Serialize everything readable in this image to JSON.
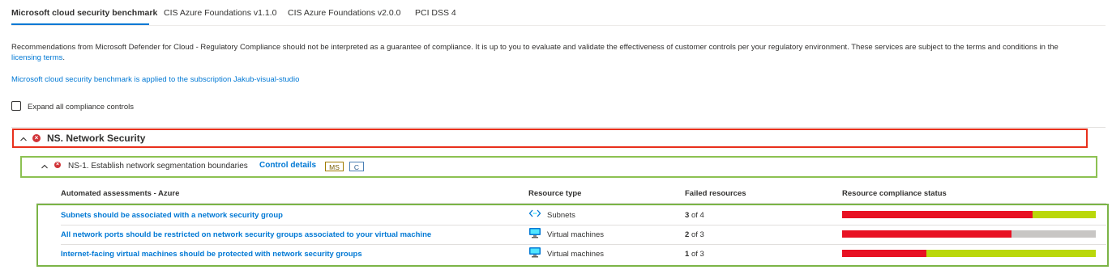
{
  "tabs": [
    {
      "label": "Microsoft cloud security benchmark",
      "active": true
    },
    {
      "label": "CIS Azure Foundations v1.1.0"
    },
    {
      "label": "CIS Azure Foundations v2.0.0"
    },
    {
      "label": "PCI DSS 4"
    }
  ],
  "disclaimer": {
    "text": "Recommendations from Microsoft Defender for Cloud - Regulatory Compliance should not be interpreted as a guarantee of compliance. It is up to you to evaluate and validate the effectiveness of customer controls per your regulatory environment. These services are subject to the terms and conditions in the",
    "link": "licensing terms",
    "end": "."
  },
  "applied_text": "Microsoft cloud security benchmark is applied to the subscription Jakub-visual-studio",
  "expand_label": "Expand all compliance controls",
  "section": {
    "title": "NS. Network Security",
    "control": {
      "title": "NS-1. Establish network segmentation boundaries",
      "details_link": "Control details",
      "badges": [
        "MS",
        "C"
      ]
    }
  },
  "table": {
    "headers": {
      "name": "Automated assessments - Azure",
      "type": "Resource type",
      "failed": "Failed resources",
      "status": "Resource compliance status"
    },
    "rows": [
      {
        "name": "Subnets should be associated with a network security group",
        "type": "Subnets",
        "type_icon": "subnet-icon",
        "failed": "3",
        "of": "of 4",
        "failed_frac": 0.75,
        "rest_color": "#bad80a"
      },
      {
        "name": "All network ports should be restricted on network security groups associated to your virtual machine",
        "type": "Virtual machines",
        "type_icon": "virtual-machine-icon",
        "failed": "2",
        "of": "of 3",
        "failed_frac": 0.667,
        "rest_color": "#c8c6c4"
      },
      {
        "name": "Internet-facing virtual machines should be protected with network security groups",
        "type": "Virtual machines",
        "type_icon": "virtual-machine-icon",
        "failed": "1",
        "of": "of 3",
        "failed_frac": 0.333,
        "rest_color": "#bad80a"
      }
    ]
  },
  "colors": {
    "failed": "#e81123",
    "link": "#0078d4",
    "error": "#d13438"
  }
}
